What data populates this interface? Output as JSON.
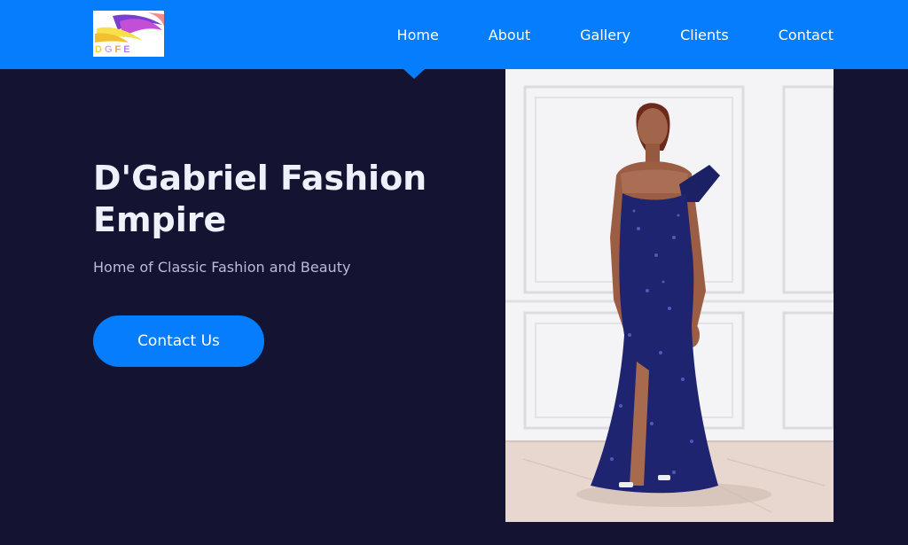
{
  "brand": {
    "logo_text": [
      "D",
      "G",
      "F",
      "E"
    ]
  },
  "nav": {
    "items": [
      {
        "label": "Home",
        "active": true
      },
      {
        "label": "About",
        "active": false
      },
      {
        "label": "Gallery",
        "active": false
      },
      {
        "label": "Clients",
        "active": false
      },
      {
        "label": "Contact",
        "active": false
      }
    ]
  },
  "hero": {
    "title": "D'Gabriel Fashion Empire",
    "subtitle": "Home of Classic Fashion and Beauty",
    "cta_label": "Contact Us"
  },
  "colors": {
    "nav_bg": "#057dfc",
    "page_bg": "#141432",
    "button_bg": "#057dfc",
    "title_text": "#eef0fa",
    "subtitle_text": "#bbbbd8"
  },
  "photo": {
    "icon": "model-photo"
  }
}
